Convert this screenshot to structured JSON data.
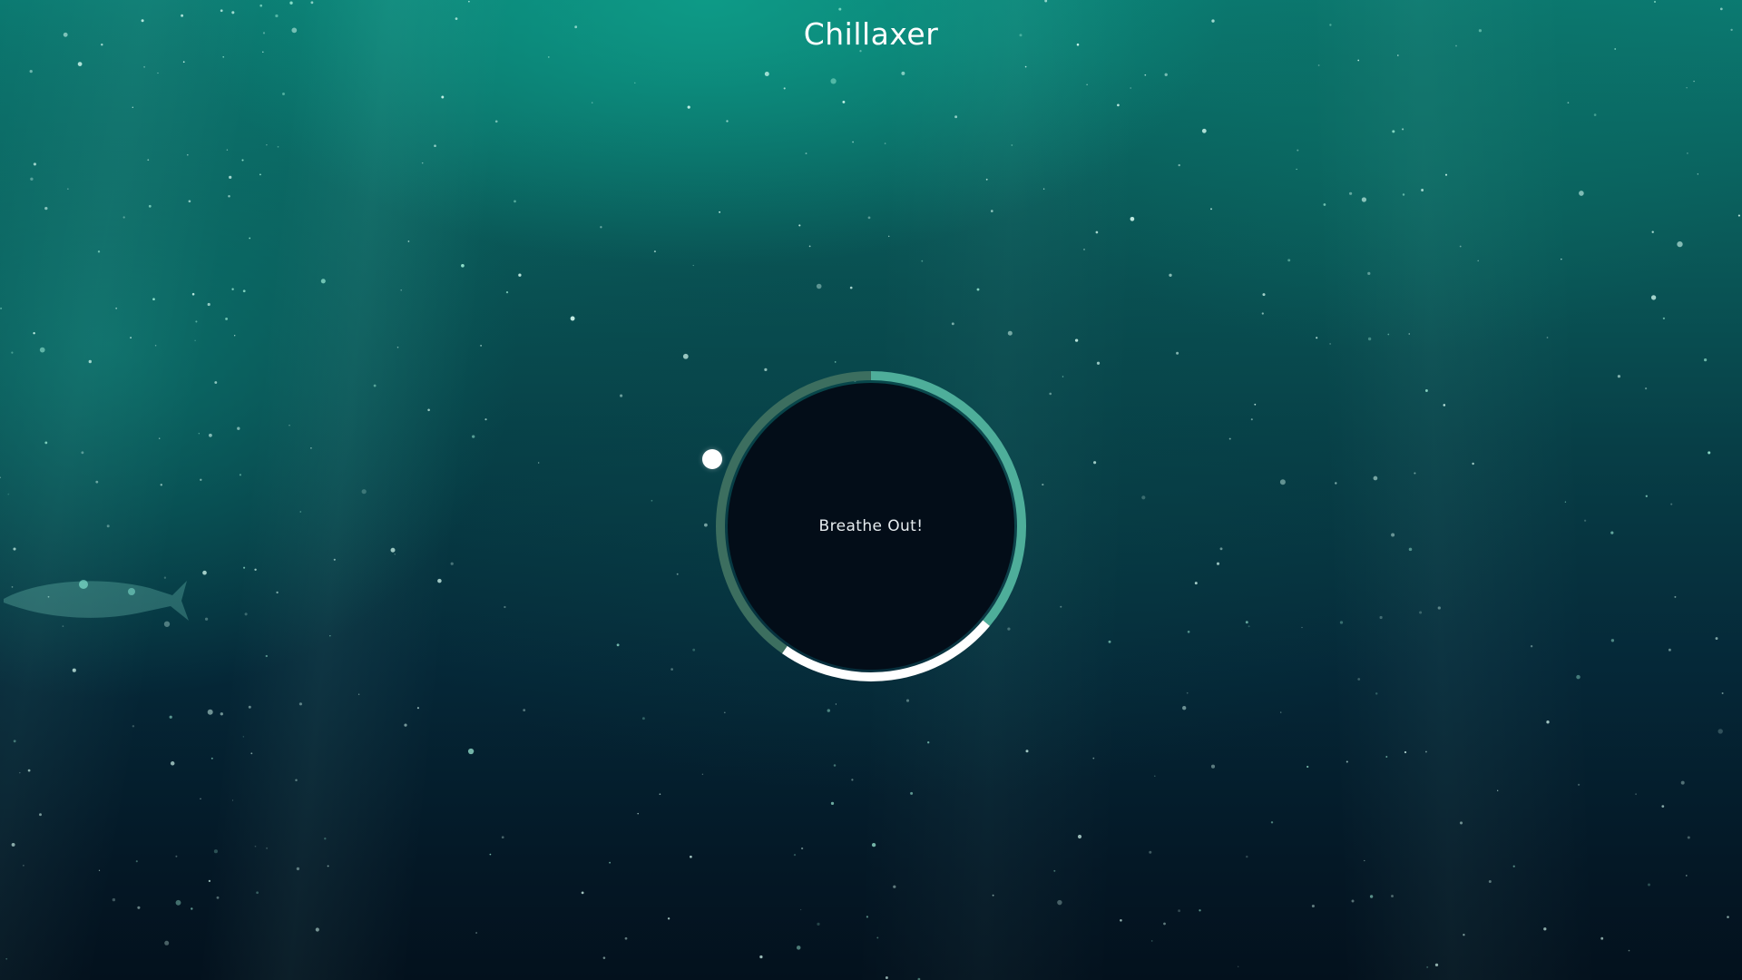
{
  "app": {
    "title": "Chillaxer"
  },
  "breathing": {
    "instruction": "Breathe Out!",
    "phase_progress": 0.814,
    "segments": [
      {
        "name": "breathe-in",
        "start_deg": 0,
        "end_deg": 130,
        "color": "#4eae9a"
      },
      {
        "name": "hold",
        "start_deg": 130,
        "end_deg": 215,
        "color": "#ffffff"
      },
      {
        "name": "breathe-out",
        "start_deg": 215,
        "end_deg": 360,
        "color": "#3c6e5f"
      }
    ]
  },
  "theme": {
    "accent": "#4eae9a",
    "hold": "#ffffff",
    "dim": "#3c6e5f",
    "core": "#030d18"
  }
}
